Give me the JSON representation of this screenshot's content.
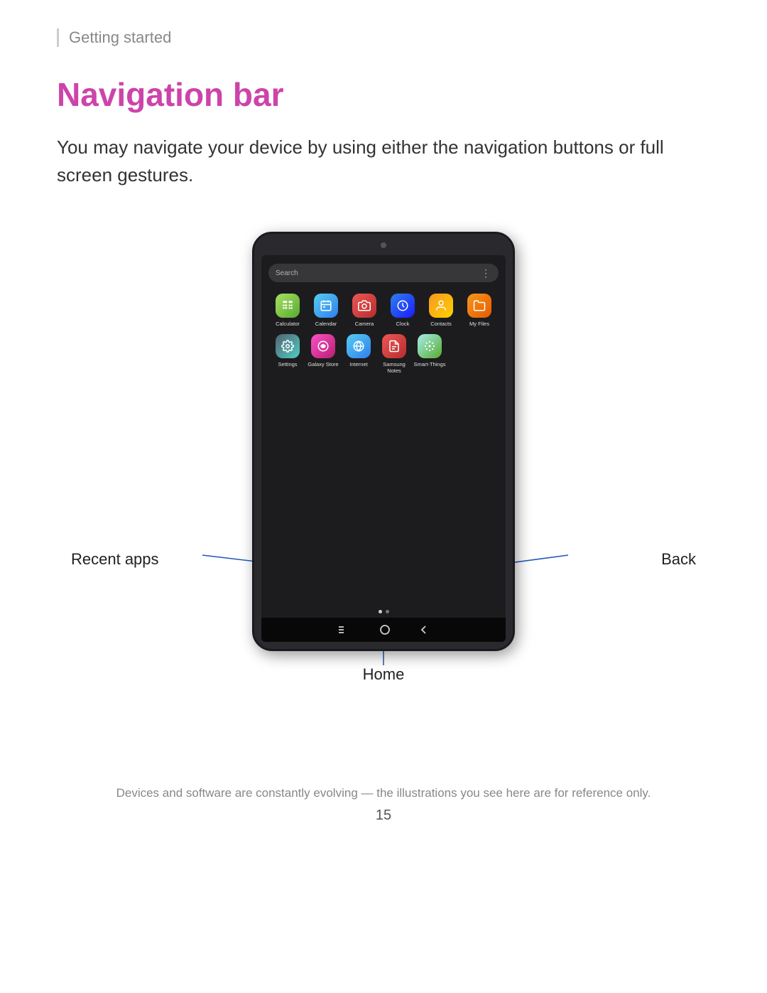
{
  "breadcrumb": {
    "text": "Getting started"
  },
  "page": {
    "title": "Navigation bar",
    "description": "You may navigate your device by using either the navigation buttons or full screen gestures.",
    "footer": "Devices and software are constantly evolving — the illustrations you see here are for reference only.",
    "page_number": "15"
  },
  "tablet": {
    "search_placeholder": "Search",
    "apps_row1": [
      {
        "label": "Calculator",
        "icon_class": "icon-calculator",
        "symbol": "🧮"
      },
      {
        "label": "Calendar",
        "icon_class": "icon-calendar",
        "symbol": "📅"
      },
      {
        "label": "Camera",
        "icon_class": "icon-camera",
        "symbol": "📷"
      },
      {
        "label": "Clock",
        "icon_class": "icon-clock",
        "symbol": "🕐"
      },
      {
        "label": "Contacts",
        "icon_class": "icon-contacts",
        "symbol": "👤"
      },
      {
        "label": "My Files",
        "icon_class": "icon-myfiles",
        "symbol": "📁"
      }
    ],
    "apps_row2": [
      {
        "label": "Settings",
        "icon_class": "icon-settings",
        "symbol": "⚙"
      },
      {
        "label": "Galaxy Store",
        "icon_class": "icon-galaxy",
        "symbol": "🛍"
      },
      {
        "label": "Internet",
        "icon_class": "icon-internet",
        "symbol": "🌐"
      },
      {
        "label": "Samsung Notes",
        "icon_class": "icon-samsung-notes",
        "symbol": "📝"
      },
      {
        "label": "Smart-Things",
        "icon_class": "icon-smart-things",
        "symbol": "✳"
      }
    ]
  },
  "callouts": {
    "recent_apps": "Recent apps",
    "home": "Home",
    "back": "Back"
  },
  "colors": {
    "accent": "#cc44aa",
    "callout_line": "#2255bb"
  }
}
